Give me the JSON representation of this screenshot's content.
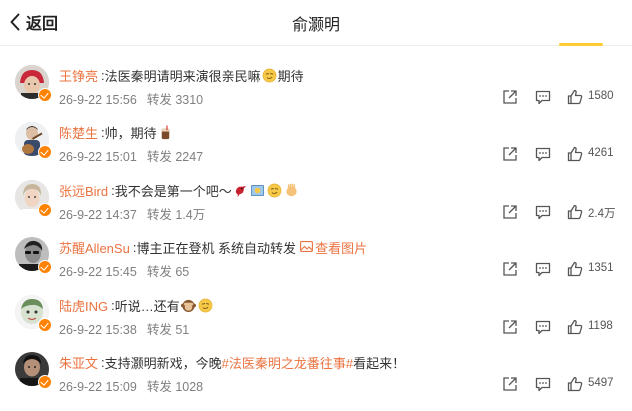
{
  "header": {
    "back_label": "返回",
    "title": "俞灏明",
    "accent_color": "#ffcc33"
  },
  "colors": {
    "name": "#eb7340",
    "text": "#333333",
    "meta": "#808080",
    "badge": "#ff8200"
  },
  "rows": [
    {
      "name": "王铮亮",
      "sep": ":",
      "text_before": "法医秦明请明来演很亲民嘛",
      "emojis": [
        "smirk-emoji"
      ],
      "text_after": "期待",
      "time": "26-9-22 15:56",
      "forward": "转发 3310",
      "likes": "1580",
      "avatar": "avatar-red-hat"
    },
    {
      "name": "陈楚生",
      "sep": ":",
      "text_before": "帅，期待",
      "emojis": [
        "drink-emoji"
      ],
      "text_after": "",
      "time": "26-9-22 15:01",
      "forward": "转发 2247",
      "likes": "4261",
      "avatar": "avatar-guitar"
    },
    {
      "name": "张远Bird",
      "sep": ":",
      "text_before": "我不会是第一个吧～",
      "emojis": [
        "bird-emoji",
        "frame-emoji",
        "smirk-emoji",
        "hands-emoji"
      ],
      "text_after": "",
      "time": "26-9-22 14:37",
      "forward": "转发 1.4万",
      "likes": "2.4万",
      "avatar": "avatar-portrait"
    },
    {
      "name": "苏醒AllenSu",
      "sep": ":",
      "text_before": "博主正在登机 系统自动转发",
      "emojis": [],
      "text_after": "",
      "pic_link": "查看图片",
      "time": "26-9-22 15:45",
      "forward": "转发 65",
      "likes": "1351",
      "avatar": "avatar-bw"
    },
    {
      "name": "陆虎ING",
      "sep": ":",
      "text_before": "听说…还有",
      "emojis": [
        "monkey-emoji",
        "smirk-emoji"
      ],
      "text_after": "",
      "time": "26-9-22 15:38",
      "forward": "转发 51",
      "likes": "1198",
      "avatar": "avatar-cartoon"
    },
    {
      "name": "朱亚文",
      "sep": ":",
      "text_before": "支持灏明新戏，今晚",
      "topic": "#法医秦明之龙番往事#",
      "emojis": [],
      "text_after": " 看起来！",
      "time": "26-9-22 15:09",
      "forward": "转发 1028",
      "likes": "5497",
      "avatar": "avatar-dark"
    }
  ],
  "icons": {
    "share": "share-icon",
    "comment": "comment-icon",
    "like": "like-icon",
    "back": "chevron-left-icon",
    "picture": "picture-icon"
  }
}
